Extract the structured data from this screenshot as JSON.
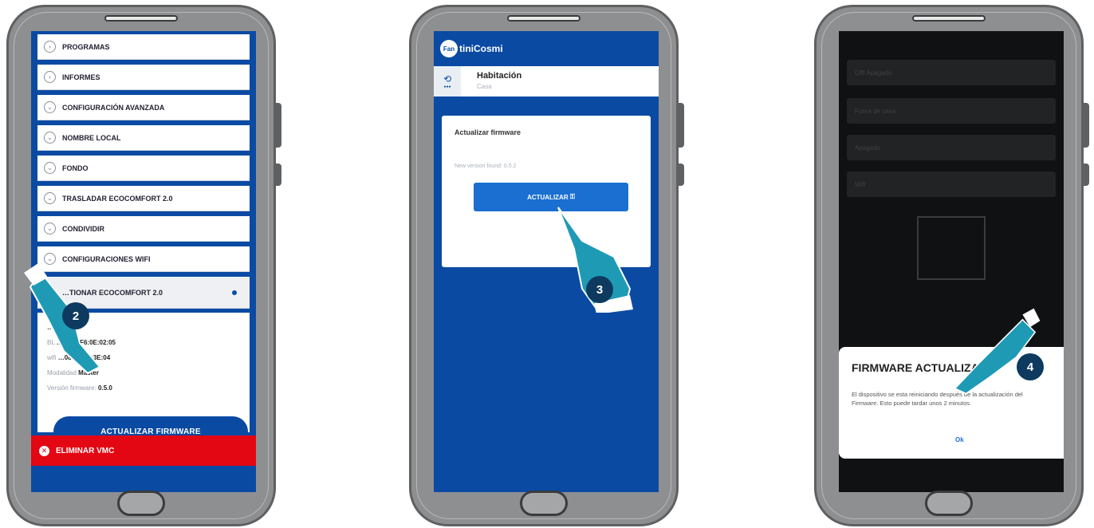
{
  "colors": {
    "brand_blue": "#0a4aa3",
    "delete_red": "#e30613",
    "badge": "#0d3a5e"
  },
  "phone1": {
    "menu": [
      {
        "label": "PROGRAMAS",
        "icon": "chevron-right-icon"
      },
      {
        "label": "INFORMES",
        "icon": "chevron-right-icon"
      },
      {
        "label": "CONFIGURACIÓN AVANZADA",
        "icon": "chevron-down-icon"
      },
      {
        "label": "NOMBRE LOCAL",
        "icon": "chevron-down-icon"
      },
      {
        "label": "FONDO",
        "icon": "chevron-down-icon"
      },
      {
        "label": "TRASLADAR ECOCOMFORT 2.0",
        "icon": "chevron-down-icon"
      },
      {
        "label": "CONDIVIDIR",
        "icon": "chevron-down-icon"
      },
      {
        "label": "CONFIGURACIONES WIFI",
        "icon": "chevron-down-icon"
      },
      {
        "label": "…TIONAR ECOCOMFORT 2.0",
        "icon": "chevron-up-icon"
      }
    ],
    "info_lines": [
      {
        "label": "",
        "value": "…0000014"
      },
      {
        "label": "BL",
        "value": "…C:4D:F6:0E:02:05"
      },
      {
        "label": "wifi",
        "value": "…08:84:1B:3E:04"
      },
      {
        "label": "Modalidad",
        "value": "Máster"
      },
      {
        "label": "Versión firmware:",
        "value": "0.5.0"
      }
    ],
    "update_button": "ACTUALIZAR FIRMWARE",
    "delete_button": "ELIMINAR VMC",
    "step": "2"
  },
  "phone2": {
    "logo_mark": "Fan",
    "logo_text": "tiniCosmi",
    "room_title": "Habitación",
    "room_subtitle": "Casa",
    "card_title": "Actualizar firmware",
    "card_text": "New version found: 0.5.2",
    "button": "ACTUALIZAR",
    "step": "3"
  },
  "phone3": {
    "rows": [
      "Off/ Apagado",
      "Fuera de casa",
      "Apagado",
      "Wifi"
    ],
    "dialog_title": "FIRMWARE ACTUALIZAD",
    "dialog_text": "El dispositivo se esta reiniciando después de la actualización del Firmware. Esto puede tardar unos 2 minutos.",
    "ok": "Ok",
    "step": "4"
  }
}
